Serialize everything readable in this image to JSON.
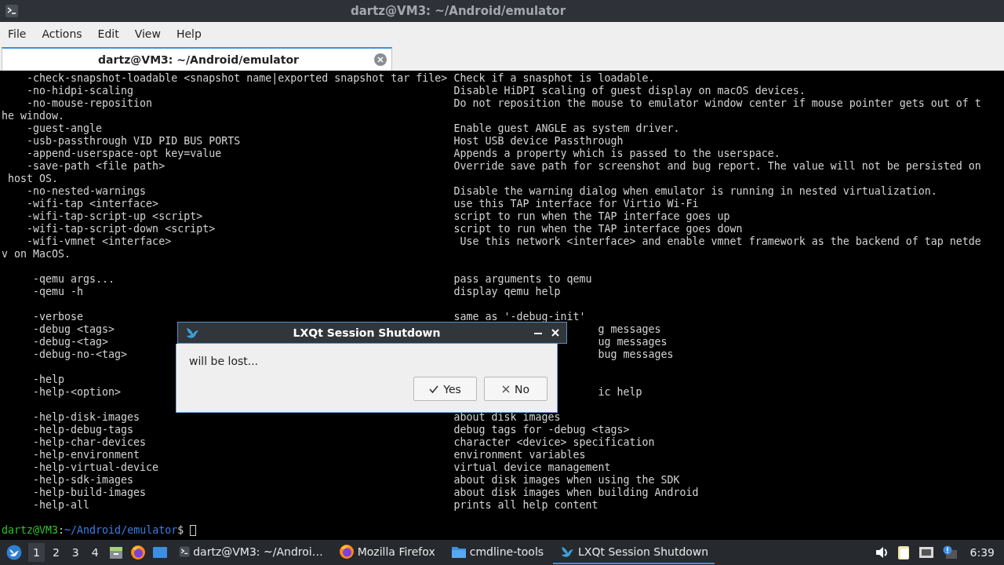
{
  "window": {
    "title": "dartz@VM3: ~/Android/emulator"
  },
  "menu": [
    "File",
    "Actions",
    "Edit",
    "View",
    "Help"
  ],
  "tabs": [
    {
      "label": "dartz@VM3: ~/Android/emulator",
      "selected": true
    }
  ],
  "terminal": {
    "lines": [
      {
        "kind": "option",
        "option": "-check-snapshot-loadable <snapshot name|exported snapshot tar file>",
        "description": "Check if a snasphot is loadable."
      },
      {
        "kind": "option",
        "option": "-no-hidpi-scaling",
        "description": "Disable HiDPI scaling of guest display on macOS devices."
      },
      {
        "kind": "option",
        "option": "-no-mouse-reposition",
        "description": "Do not reposition the mouse to emulator window center if mouse pointer gets out of t"
      },
      {
        "kind": "wrap",
        "text": "he window."
      },
      {
        "kind": "option",
        "option": "-guest-angle",
        "description": "Enable guest ANGLE as system driver."
      },
      {
        "kind": "option",
        "option": "-usb-passthrough VID PID BUS PORTS",
        "description": "Host USB device Passthrough"
      },
      {
        "kind": "option",
        "option": "-append-userspace-opt key=value",
        "description": "Appends a property which is passed to the userspace."
      },
      {
        "kind": "option",
        "option": "-save-path <file path>",
        "description": "Override save path for screenshot and bug report. The value will not be persisted on"
      },
      {
        "kind": "wrap",
        "text": " host OS."
      },
      {
        "kind": "option",
        "option": "-no-nested-warnings",
        "description": "Disable the warning dialog when emulator is running in nested virtualization."
      },
      {
        "kind": "option",
        "option": "-wifi-tap <interface>",
        "description": "use this TAP interface for Virtio Wi-Fi"
      },
      {
        "kind": "option",
        "option": "-wifi-tap-script-up <script>",
        "description": "script to run when the TAP interface goes up"
      },
      {
        "kind": "option",
        "option": "-wifi-tap-script-down <script>",
        "description": "script to run when the TAP interface goes down"
      },
      {
        "kind": "option",
        "option": "-wifi-vmnet <interface>",
        "description": " Use this network <interface> and enable vmnet framework as the backend of tap netde"
      },
      {
        "kind": "wrap",
        "text": "v on MacOS."
      },
      {
        "kind": "blank"
      },
      {
        "kind": "sub_option",
        "option": "-qemu args...",
        "description": "pass arguments to qemu"
      },
      {
        "kind": "sub_option",
        "option": "-qemu -h",
        "description": "display qemu help"
      },
      {
        "kind": "blank"
      },
      {
        "kind": "sub_option",
        "option": "-verbose",
        "description": "same as '-debug-init'"
      },
      {
        "kind": "covered",
        "option": "-debug <tags>",
        "description": "g messages"
      },
      {
        "kind": "covered",
        "option": "-debug-<tag>",
        "description": "ug messages"
      },
      {
        "kind": "covered",
        "option": "-debug-no-<tag>",
        "description": "bug messages"
      },
      {
        "kind": "blank"
      },
      {
        "kind": "sub_option",
        "option": "-help"
      },
      {
        "kind": "covered",
        "option": "-help-<option>",
        "description": "ic help"
      },
      {
        "kind": "blank"
      },
      {
        "kind": "sub_option",
        "option": "-help-disk-images",
        "description": "about disk images"
      },
      {
        "kind": "sub_option",
        "option": "-help-debug-tags",
        "description": "debug tags for -debug <tags>"
      },
      {
        "kind": "sub_option",
        "option": "-help-char-devices",
        "description": "character <device> specification"
      },
      {
        "kind": "sub_option",
        "option": "-help-environment",
        "description": "environment variables"
      },
      {
        "kind": "sub_option",
        "option": "-help-virtual-device",
        "description": "virtual device management"
      },
      {
        "kind": "sub_option",
        "option": "-help-sdk-images",
        "description": "about disk images when using the SDK"
      },
      {
        "kind": "sub_option",
        "option": "-help-build-images",
        "description": "about disk images when building Android"
      },
      {
        "kind": "sub_option",
        "option": "-help-all",
        "description": "prints all help content"
      },
      {
        "kind": "blank"
      }
    ],
    "prompt": {
      "user_host": "dartz@VM3",
      "separator": ":",
      "path": "~/Android/emulator",
      "symbol": "$"
    }
  },
  "dialog": {
    "title": "LXQt Session Shutdown",
    "message": "will be lost...",
    "buttons": [
      {
        "label": "Yes",
        "kind": "yes"
      },
      {
        "label": "No",
        "kind": "no"
      }
    ]
  },
  "taskbar": {
    "desktops": [
      {
        "label": "1",
        "selected": true
      },
      {
        "label": "2",
        "selected": false
      },
      {
        "label": "3",
        "selected": false
      },
      {
        "label": "4",
        "selected": false
      }
    ],
    "tasks": [
      {
        "label": "dartz@VM3: ~/Androi…",
        "kind": "terminal",
        "selected": false
      },
      {
        "label": "Mozilla Firefox",
        "kind": "browser",
        "selected": false
      },
      {
        "label": "cmdline-tools",
        "kind": "folder",
        "selected": false
      },
      {
        "label": "LXQt Session Shutdown",
        "kind": "session",
        "selected": true
      }
    ],
    "clock": "6:39"
  }
}
